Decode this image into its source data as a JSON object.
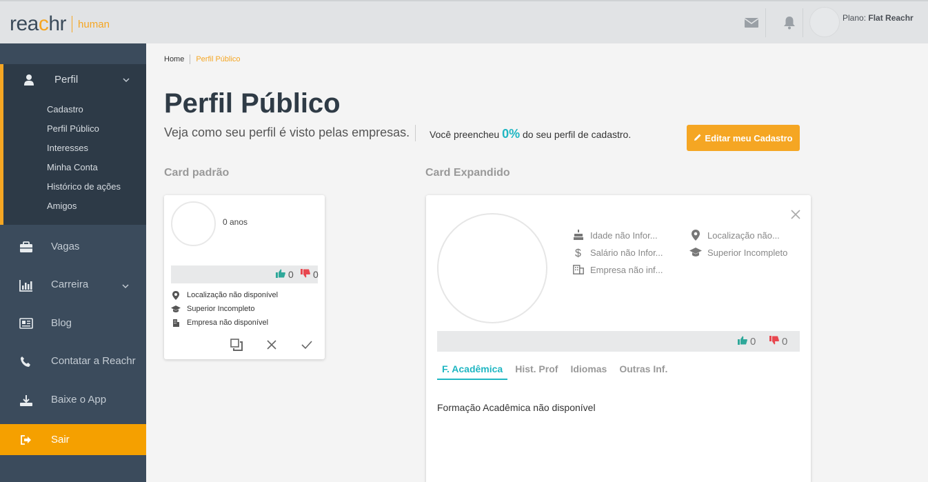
{
  "header": {
    "logo_main_a": "rea",
    "logo_main_b": "c",
    "logo_main_c": "hr",
    "logo_sub": "human",
    "plan_label": "Plano:",
    "plan_value": "Flat Reachr",
    "icons": [
      "mail-icon",
      "bell-icon"
    ]
  },
  "sidebar": {
    "perfil": {
      "label": "Perfil",
      "sub_items": [
        "Cadastro",
        "Perfil Público",
        "Interesses",
        "Minha Conta",
        "Histórico de ações",
        "Amigos"
      ]
    },
    "items": [
      {
        "label": "Vagas",
        "icon": "briefcase-icon"
      },
      {
        "label": "Carreira",
        "icon": "bar-chart-icon"
      },
      {
        "label": "Blog",
        "icon": "newspaper-icon"
      },
      {
        "label": "Contatar a Reachr",
        "icon": "phone-icon"
      },
      {
        "label": "Baixe o App",
        "icon": "download-icon"
      },
      {
        "label": "Sair",
        "icon": "sign-out-icon"
      }
    ],
    "accent": "#f5a623"
  },
  "breadcrumb": {
    "home": "Home",
    "current": "Perfil Público"
  },
  "page": {
    "title": "Perfil Público",
    "subtitle": "Veja como seu perfil é visto pelas empresas.",
    "progress_prefix": "Você preencheu",
    "progress_value": "0%",
    "progress_suffix": "do seu perfil de cadastro.",
    "edit_button": "Editar meu Cadastro"
  },
  "card_padrao": {
    "section_title": "Card padrão",
    "age": "0 anos",
    "likes": "0",
    "dislikes": "0",
    "location": "Localização não disponível",
    "education": "Superior Incompleto",
    "company": "Empresa não disponível"
  },
  "card_expandido": {
    "section_title": "Card Expandido",
    "age": "Idade não Infor...",
    "location": "Localização não...",
    "salary": "Salário não Infor...",
    "education": "Superior Incompleto",
    "company": "Empresa não inf...",
    "likes": "0",
    "dislikes": "0",
    "tabs": [
      "F. Acadêmica",
      "Hist. Prof",
      "Idiomas",
      "Outras Inf."
    ],
    "active_tab": "F. Acadêmica",
    "content": "Formação Acadêmica não disponível"
  },
  "colors": {
    "primary": "#f5a623",
    "teal": "#1fb6c2",
    "like": "#2fa89a",
    "dislike": "#e8474f"
  }
}
